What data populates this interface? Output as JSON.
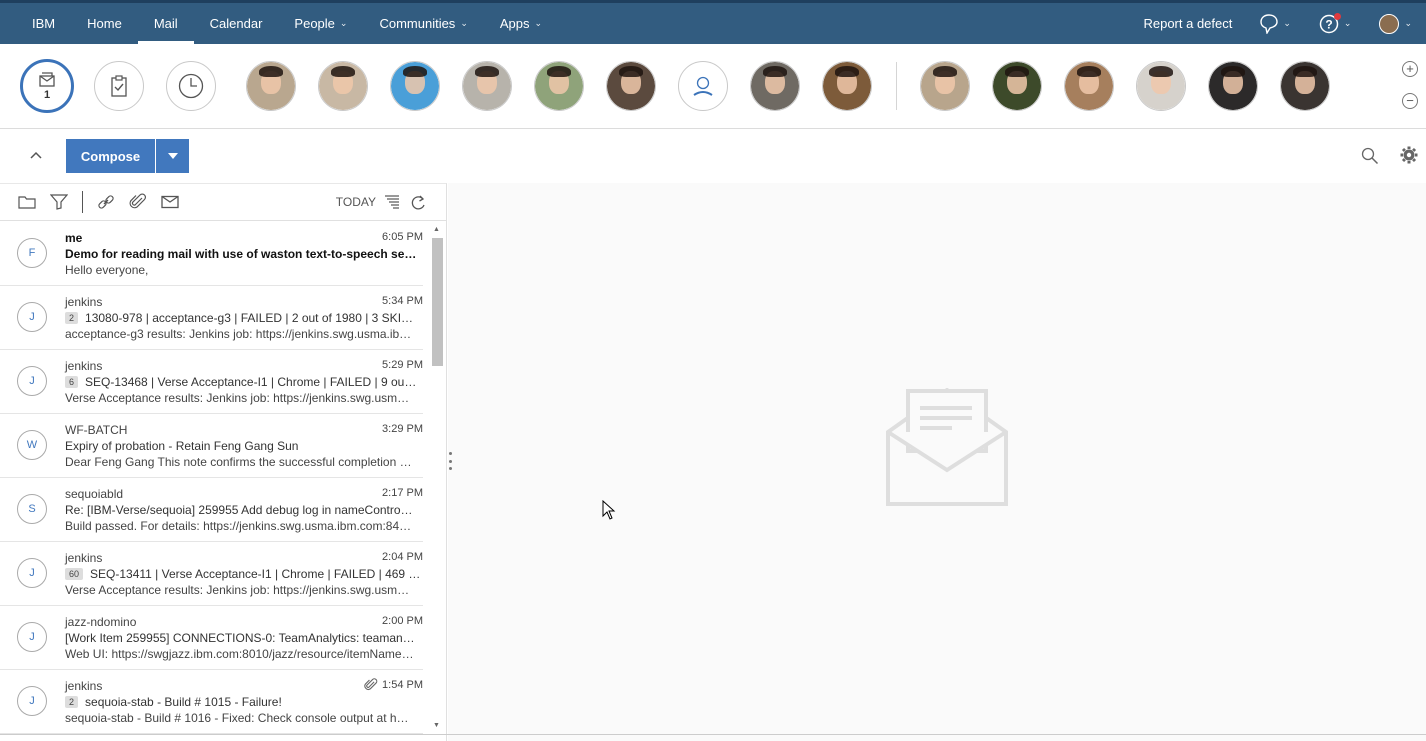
{
  "nav": {
    "items": [
      {
        "label": "IBM",
        "active": false,
        "dropdown": false
      },
      {
        "label": "Home",
        "active": false,
        "dropdown": false
      },
      {
        "label": "Mail",
        "active": true,
        "dropdown": false
      },
      {
        "label": "Calendar",
        "active": false,
        "dropdown": false
      },
      {
        "label": "People",
        "active": false,
        "dropdown": true
      },
      {
        "label": "Communities",
        "active": false,
        "dropdown": true
      },
      {
        "label": "Apps",
        "active": false,
        "dropdown": true
      }
    ],
    "report_defect": "Report a defect",
    "colors": {
      "bar": "#325c80",
      "accent": "#4178be"
    }
  },
  "peoplebar": {
    "inbox_badge": "1",
    "icons": [
      "envelope-stack-icon",
      "clipboard-check-icon",
      "clock-icon"
    ]
  },
  "compose": {
    "label": "Compose"
  },
  "toolbar": {
    "today_label": "TODAY"
  },
  "messages": [
    {
      "initial": "F",
      "from": "me",
      "time": "6:05 PM",
      "count": "",
      "subject": "Demo for reading mail with use of waston text-to-speech ser…",
      "preview": "Hello everyone,",
      "unread": true,
      "attachment": false
    },
    {
      "initial": "J",
      "from": "jenkins",
      "time": "5:34 PM",
      "count": "2",
      "subject": "13080-978 | acceptance-g3 | FAILED | 2 out of 1980 | 3 SKI…",
      "preview": "acceptance-g3 results: Jenkins job: https://jenkins.swg.usma.ib…",
      "unread": false,
      "attachment": false
    },
    {
      "initial": "J",
      "from": "jenkins",
      "time": "5:29 PM",
      "count": "6",
      "subject": "SEQ-13468 | Verse Acceptance-I1 | Chrome | FAILED | 9 ou…",
      "preview": "Verse Acceptance results: Jenkins job: https://jenkins.swg.usm…",
      "unread": false,
      "attachment": false
    },
    {
      "initial": "W",
      "from": "WF-BATCH",
      "time": "3:29 PM",
      "count": "",
      "subject": "Expiry of probation - Retain Feng Gang Sun",
      "preview": "Dear Feng Gang This note confirms the successful completion …",
      "unread": false,
      "attachment": false
    },
    {
      "initial": "S",
      "from": "sequoiabld",
      "time": "2:17 PM",
      "count": "",
      "subject": "Re: [IBM-Verse/sequoia] 259955 Add debug log in nameContro…",
      "preview": "Build passed. For details: https://jenkins.swg.usma.ibm.com:84…",
      "unread": false,
      "attachment": false
    },
    {
      "initial": "J",
      "from": "jenkins",
      "time": "2:04 PM",
      "count": "60",
      "subject": "SEQ-13411 | Verse Acceptance-I1 | Chrome | FAILED | 469 …",
      "preview": "Verse Acceptance results: Jenkins job: https://jenkins.swg.usm…",
      "unread": false,
      "attachment": false
    },
    {
      "initial": "J",
      "from": "jazz-ndomino",
      "time": "2:00 PM",
      "count": "",
      "subject": "[Work Item 259955] CONNECTIONS-0: TeamAnalytics: teaman…",
      "preview": "Web UI: https://swgjazz.ibm.com:8010/jazz/resource/itemName…",
      "unread": false,
      "attachment": false
    },
    {
      "initial": "J",
      "from": "jenkins",
      "time": "1:54 PM",
      "count": "2",
      "subject": "sequoia-stab - Build # 1015 - Failure!",
      "preview": "sequoia-stab - Build # 1016 - Fixed: Check console output at h…",
      "unread": false,
      "attachment": true
    }
  ]
}
